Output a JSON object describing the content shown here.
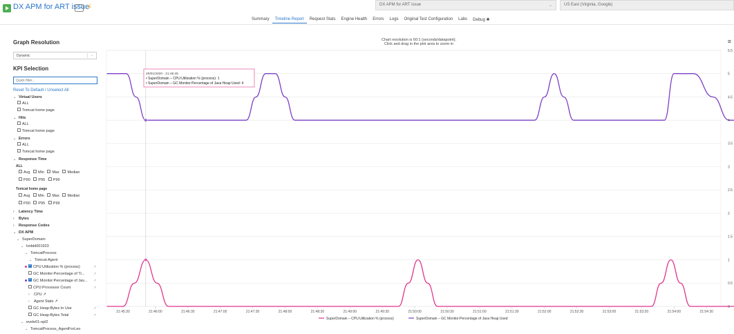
{
  "header": {
    "test_title": "DX APM for ART issue",
    "more_label": "···",
    "selected_test": "DX APM for ART issue",
    "selected_region": "US East (Virginia, Google)"
  },
  "tabs": [
    {
      "label": "Summary",
      "active": false
    },
    {
      "label": "Timeline Report",
      "active": true
    },
    {
      "label": "Request Stats",
      "active": false
    },
    {
      "label": "Engine Health",
      "active": false
    },
    {
      "label": "Errors",
      "active": false
    },
    {
      "label": "Logs",
      "active": false
    },
    {
      "label": "Original Test Configuration",
      "active": false
    },
    {
      "label": "Labs",
      "active": false
    },
    {
      "label": "Debug",
      "active": false
    }
  ],
  "sidebar": {
    "graph_resolution_heading": "Graph Resolution",
    "resolution_value": "Dynamic",
    "kpi_heading": "KPI Selection",
    "filter_placeholder": "Quick filter...",
    "reset_link": "Reset To Default / Unselect All",
    "virtual_users": {
      "label": "Virtual Users",
      "items": [
        "ALL",
        "Tomcat home page"
      ]
    },
    "hits": {
      "label": "Hits",
      "items": [
        "ALL",
        "Tomcat home page"
      ]
    },
    "errors": {
      "label": "Errors",
      "items": [
        "ALL",
        "Tomcat home page"
      ]
    },
    "response_time": {
      "label": "Response Time",
      "sub_all": "ALL",
      "sub_page": "Tomcat home page",
      "stats_row1": [
        "Avg",
        "Min",
        "Max",
        "Median"
      ],
      "stats_row2": [
        "P90",
        "P95",
        "P99"
      ]
    },
    "latency_time": "Latency Time",
    "bytes": "Bytes",
    "response_codes": "Response Codes",
    "dx_apm": {
      "label": "DX APM",
      "domain": "SuperDomain",
      "host": "lvnbld001923",
      "process": "TomcatProcess",
      "agent": "Tomcat Agent",
      "metrics": [
        {
          "label": "CPU:Utilization % (process)",
          "checked": true,
          "color": "#e0358c"
        },
        {
          "label": "GC Monitor:Percentage of Ti...",
          "checked": false
        },
        {
          "label": "GC Monitor:Percentage of Jav...",
          "checked": true,
          "color": "#7b3fc4"
        },
        {
          "label": "CPU:Processor Count",
          "checked": false
        }
      ],
      "cpu_folder": "CPU",
      "agent_stats_folder": "Agent Stats",
      "heap_metrics": [
        "GC Heap:Bytes In Use",
        "GC Heap:Bytes Total"
      ],
      "host2": "evele01-opl2",
      "process2": "TomcatProcess_AgentForLeo"
    }
  },
  "chart_note_line1": "Chart resolution is 60:1 (seconds/datapoint);",
  "chart_note_line2": "Click and drag in the plot area to zoom in",
  "tooltip": {
    "time": "20/01/2020 - 21:45:45",
    "line1": "• SuperDomain – CPU:Utilization % (process): 1",
    "line2": "• SuperDomain – GC Monitor:Percentage of Java Heap Used: 4"
  },
  "chart_data": {
    "type": "line",
    "x_ticks": [
      "21:45:30",
      "21:46:00",
      "21:46:30",
      "21:47:00",
      "21:47:30",
      "21:48:00",
      "21:48:30",
      "21:49:00",
      "21:49:30",
      "21:50:00",
      "21:50:30",
      "21:51:00",
      "21:51:30",
      "21:52:00",
      "21:52:30",
      "21:53:00",
      "21:53:30",
      "21:54:00",
      "21:54:30"
    ],
    "y_ticks": [
      "0",
      "0.5",
      "1",
      "1.5",
      "2",
      "2.5",
      "3",
      "3.5",
      "4",
      "4.5",
      "5",
      "5.5"
    ],
    "ylim": [
      0,
      5.5
    ],
    "grid": true,
    "legend_position": "bottom",
    "series": [
      {
        "name": "SuperDomain – CPU:Utilization % (process)",
        "color": "#e0358c",
        "points": [
          [
            -0.5,
            0
          ],
          [
            0,
            0
          ],
          [
            0.35,
            0.5
          ],
          [
            0.7,
            1
          ],
          [
            1.05,
            0.5
          ],
          [
            1.4,
            0
          ],
          [
            8.5,
            0
          ],
          [
            8.8,
            0.5
          ],
          [
            9.1,
            1
          ],
          [
            9.4,
            0.5
          ],
          [
            9.7,
            0
          ],
          [
            16.3,
            0
          ],
          [
            16.6,
            0.5
          ],
          [
            16.9,
            1
          ],
          [
            17.2,
            0.5
          ],
          [
            17.5,
            0
          ],
          [
            19.3,
            0
          ]
        ]
      },
      {
        "name": "SuperDomain – GC Monitor:Percentage of Java Heap Used",
        "color": "#7b3fc4",
        "points": [
          [
            -0.5,
            5
          ],
          [
            0.1,
            5
          ],
          [
            0.4,
            4.5
          ],
          [
            0.7,
            4
          ],
          [
            3.8,
            4
          ],
          [
            4.1,
            4.5
          ],
          [
            4.4,
            5
          ],
          [
            4.7,
            5
          ],
          [
            5.0,
            4.5
          ],
          [
            5.3,
            4
          ],
          [
            12.7,
            4
          ],
          [
            13.0,
            4.5
          ],
          [
            13.3,
            5
          ],
          [
            13.6,
            4.5
          ],
          [
            13.9,
            4
          ],
          [
            16.7,
            4
          ],
          [
            17.0,
            5
          ],
          [
            17.6,
            5
          ],
          [
            18.2,
            4.5
          ],
          [
            18.7,
            4
          ],
          [
            19.3,
            4
          ]
        ]
      }
    ]
  }
}
